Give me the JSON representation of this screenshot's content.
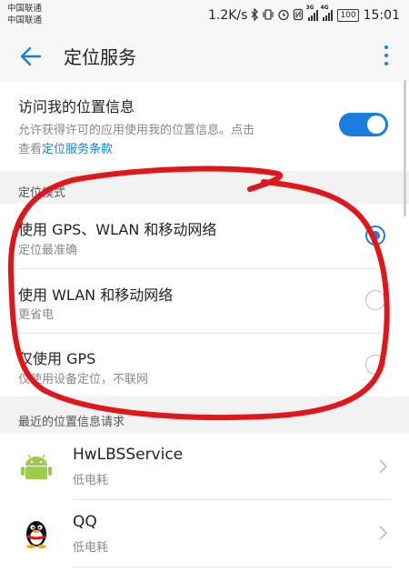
{
  "status_bar": {
    "carrier_1": "中国联通",
    "carrier_2": "中国联通",
    "speed": "1.2K/s",
    "net_3g": "3G",
    "net_4g": "4G",
    "battery": "100",
    "time": "15:01"
  },
  "header": {
    "title": "定位服务"
  },
  "location_access": {
    "title": "访问我的位置信息",
    "desc_line1": "允许获得许可的应用使用我的位置信息。点击",
    "desc_prefix": "查看",
    "desc_link": "定位服务条款",
    "enabled": true
  },
  "mode_section": {
    "header": "定位模式",
    "options": [
      {
        "title": "使用 GPS、WLAN 和移动网络",
        "subtitle": "定位最准确",
        "selected": true
      },
      {
        "title": "使用 WLAN 和移动网络",
        "subtitle": "更省电",
        "selected": false
      },
      {
        "title": "仅使用 GPS",
        "subtitle": "仅使用设备定位，不联网",
        "selected": false
      }
    ]
  },
  "recent_section": {
    "header": "最近的位置信息请求",
    "apps": [
      {
        "name": "HwLBSService",
        "usage": "低电耗",
        "icon": "android-icon"
      },
      {
        "name": "QQ",
        "usage": "低电耗",
        "icon": "qq-penguin-icon"
      }
    ]
  },
  "colors": {
    "accent": "#1a7ee0",
    "annotation": "#e0161b"
  }
}
